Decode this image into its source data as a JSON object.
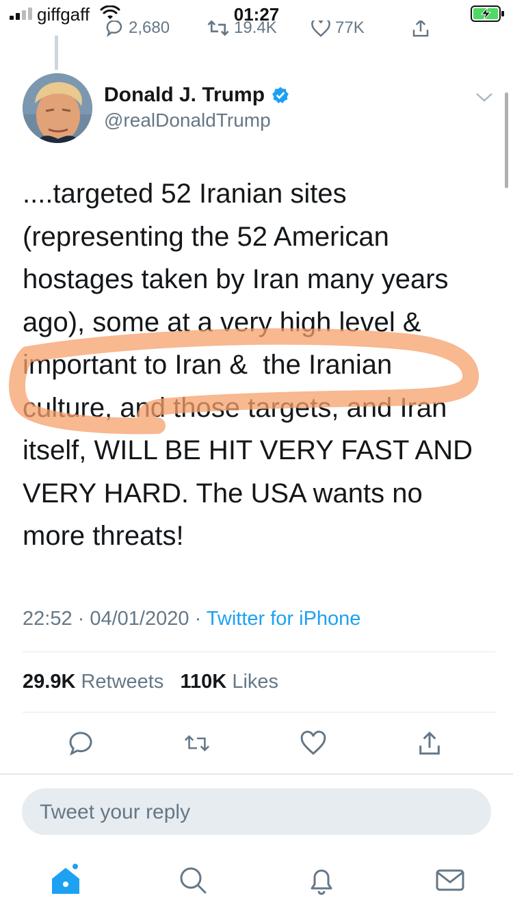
{
  "status_bar": {
    "carrier": "giffgaff",
    "time": "01:27",
    "signal_icon": "signal-bars-icon",
    "wifi_icon": "wifi-icon",
    "battery_icon": "battery-charging-icon"
  },
  "previous_tweet": {
    "replies": "2,680",
    "retweets": "19.4K",
    "likes": "77K"
  },
  "author": {
    "name": "Donald J. Trump",
    "handle": "@realDonaldTrump",
    "verified_icon": "verified-badge-icon"
  },
  "tweet": {
    "text": "....targeted 52 Iranian sites\n(representing the 52 American\nhostages taken by Iran many years\nago), some at a very high level &\nimportant to Iran &  the Iranian\nculture, and those targets, and Iran\nitself, WILL BE HIT VERY FAST AND\nVERY HARD. The USA wants no\nmore threats!",
    "time": "22:52",
    "date": "04/01/2020",
    "source": "Twitter for iPhone"
  },
  "stats": {
    "retweets_count": "29.9K",
    "retweets_label": "Retweets",
    "likes_count": "110K",
    "likes_label": "Likes"
  },
  "actions": [
    "reply-icon",
    "retweet-icon",
    "like-icon",
    "share-icon"
  ],
  "reply": {
    "placeholder": "Tweet your reply"
  },
  "tab_bar": [
    "home-icon",
    "search-icon",
    "notifications-icon",
    "messages-icon"
  ],
  "colors": {
    "accent": "#1da1f2",
    "muted": "#657786",
    "highlight": "#f6a06b"
  }
}
